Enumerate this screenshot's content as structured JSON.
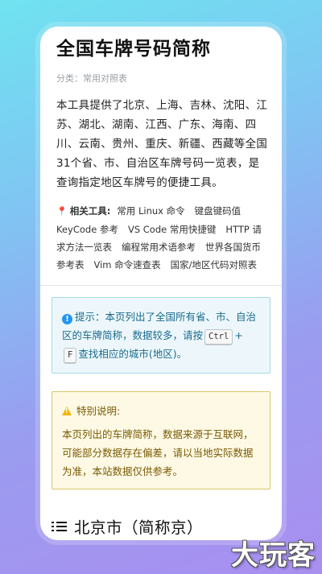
{
  "page": {
    "title": "全国车牌号码简称",
    "category": "分类：常用对照表",
    "intro": "本工具提供了北京、上海、吉林、沈阳、江苏、湖北、湖南、江西、广东、海南、四川、云南、贵州、重庆、新疆、西藏等全国31个省、市、自治区车牌号码一览表，是查询指定地区车牌号的便捷工具。"
  },
  "related": {
    "label": "相关工具:",
    "links": [
      "常用 Linux 命令",
      "键盘键码值 KeyCode 参考",
      "VS Code 常用快捷键",
      "HTTP 请求方法一览表",
      "编程常用术语参考",
      "世界各国货币参考表",
      "Vim 命令速查表",
      "国家/地区代码对照表"
    ]
  },
  "tip": {
    "text_before": "提示：本页列出了全国所有省、市、自治区的车牌简称，数据较多，请按",
    "key1": "Ctrl",
    "plus": "+",
    "key2": "F",
    "text_after": "查找相应的城市(地区)。"
  },
  "notice": {
    "title": "特别说明:",
    "body": "本页列出的车牌简称，数据来源于互联网，可能部分数据存在偏差，请以当地实际数据为准，本站数据仅供参考。"
  },
  "section": {
    "heading": "北京市（简称京）"
  },
  "watermark": "大玩客",
  "colors": {
    "tip_border": "#a8dae6",
    "tip_text": "#1a6c8e",
    "warn_border": "#d8c76a",
    "warn_text": "#7a5b06"
  }
}
